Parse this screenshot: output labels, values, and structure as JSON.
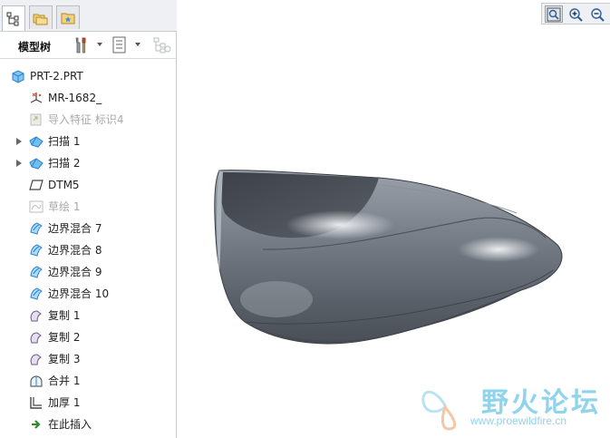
{
  "toolbar": {
    "title": "模型树"
  },
  "tree": {
    "root_label": "PRT-2.PRT",
    "items": [
      {
        "label": "MR-1682_",
        "icon": "coordinate-system-icon",
        "expandable": false,
        "disabled": false
      },
      {
        "label": "导入特征 标识4",
        "icon": "import-feature-icon",
        "expandable": false,
        "disabled": true
      },
      {
        "label": "扫描 1",
        "icon": "sweep-icon",
        "expandable": true,
        "disabled": false
      },
      {
        "label": "扫描 2",
        "icon": "sweep-icon",
        "expandable": true,
        "disabled": false
      },
      {
        "label": "DTM5",
        "icon": "datum-plane-icon",
        "expandable": false,
        "disabled": false
      },
      {
        "label": "草绘 1",
        "icon": "sketch-icon",
        "expandable": false,
        "disabled": true
      },
      {
        "label": "边界混合 7",
        "icon": "boundary-blend-icon",
        "expandable": false,
        "disabled": false
      },
      {
        "label": "边界混合 8",
        "icon": "boundary-blend-icon",
        "expandable": false,
        "disabled": false
      },
      {
        "label": "边界混合 9",
        "icon": "boundary-blend-icon",
        "expandable": false,
        "disabled": false
      },
      {
        "label": "边界混合 10",
        "icon": "boundary-blend-icon",
        "expandable": false,
        "disabled": false
      },
      {
        "label": "复制 1",
        "icon": "copy-surface-icon",
        "expandable": false,
        "disabled": false
      },
      {
        "label": "复制 2",
        "icon": "copy-surface-icon",
        "expandable": false,
        "disabled": false
      },
      {
        "label": "复制 3",
        "icon": "copy-surface-icon",
        "expandable": false,
        "disabled": false
      },
      {
        "label": "合并 1",
        "icon": "merge-icon",
        "expandable": false,
        "disabled": false
      },
      {
        "label": "加厚 1",
        "icon": "thicken-icon",
        "expandable": false,
        "disabled": false
      },
      {
        "label": "在此插入",
        "icon": "insert-here-icon",
        "expandable": false,
        "disabled": false
      }
    ]
  },
  "watermark": {
    "title": "野火论坛",
    "url": "www.proewildfire.cn"
  },
  "colors": {
    "accent": "#2a7fd4",
    "disabled_text": "#a9a9a9",
    "model_gray": "#6c737d",
    "watermark": "#8fd3ec"
  }
}
